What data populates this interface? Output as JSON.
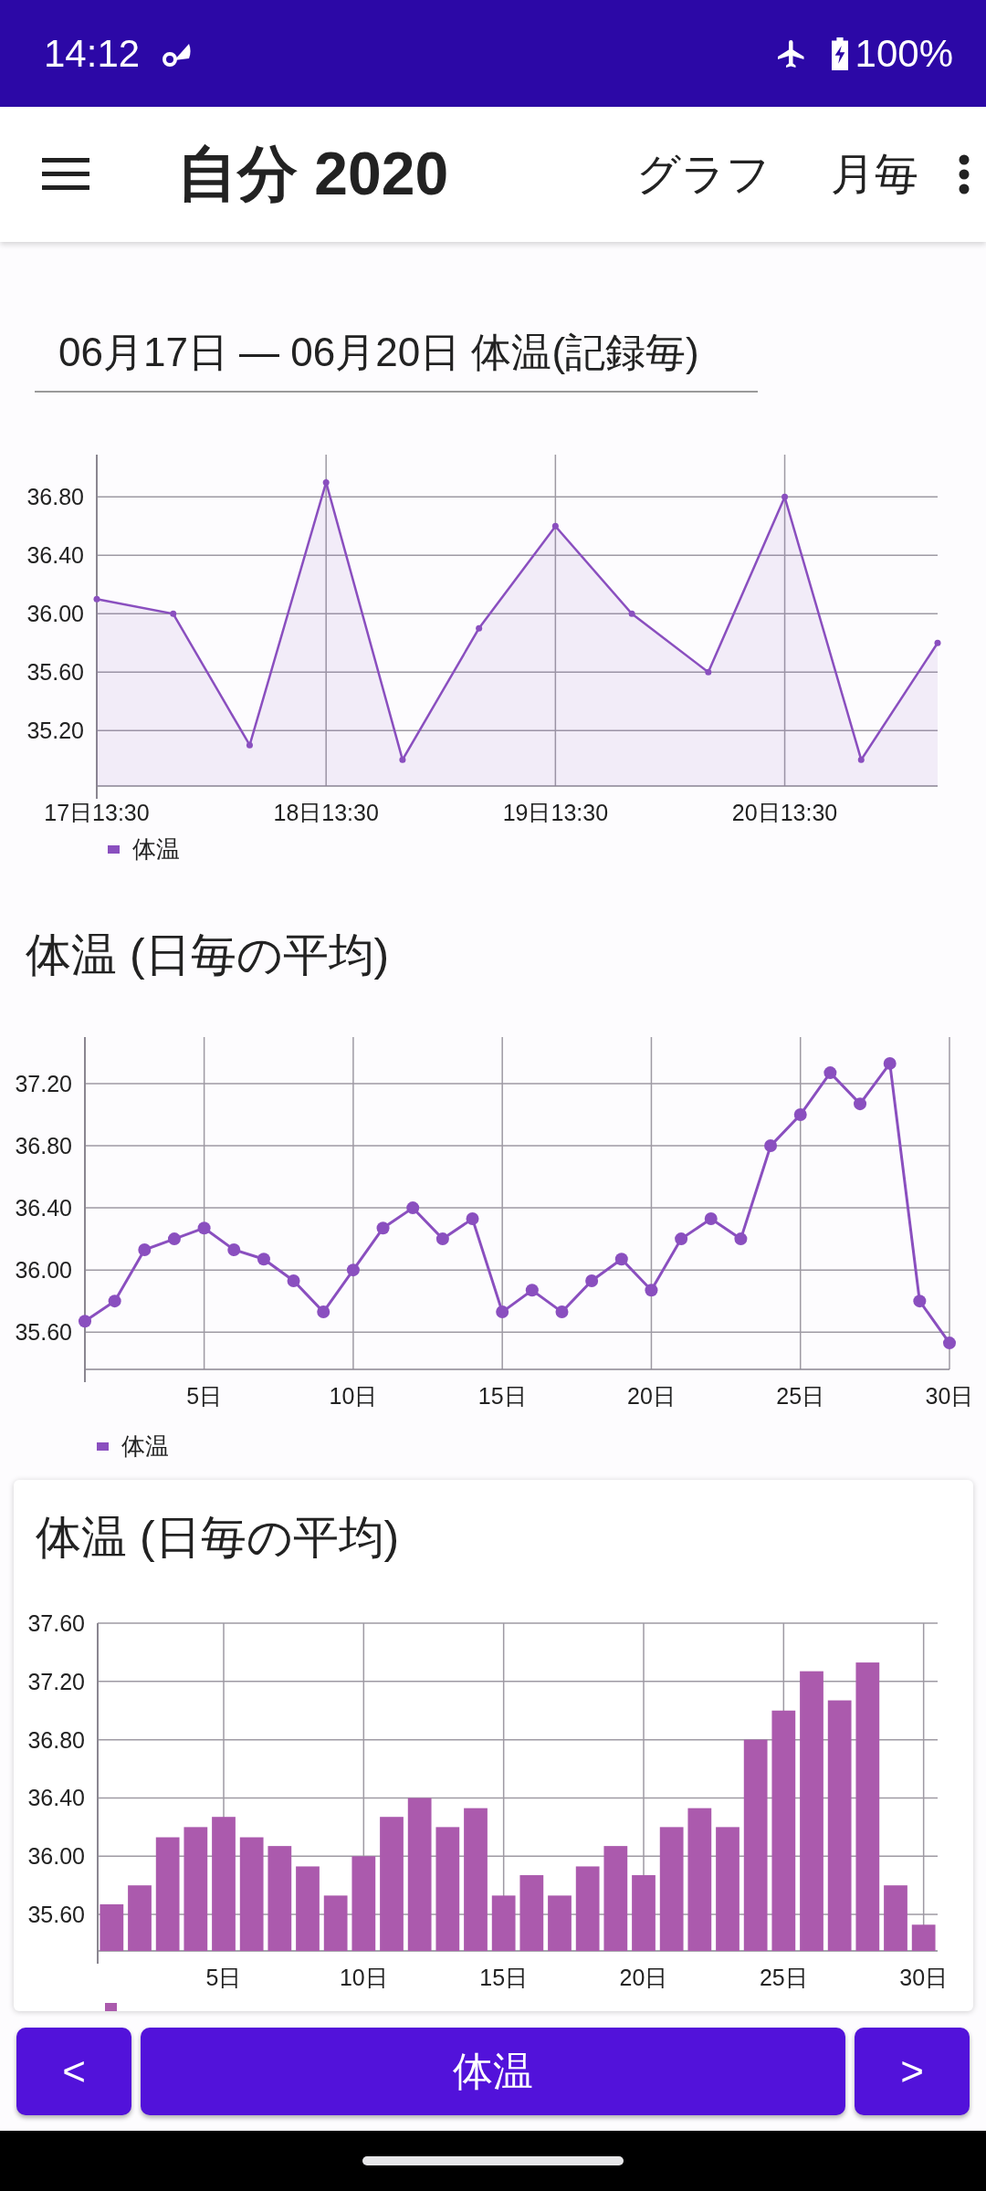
{
  "status_bar": {
    "time": "14:12",
    "battery": "100%"
  },
  "app_bar": {
    "title": "自分 2020",
    "actions": [
      "グラフ",
      "月毎"
    ]
  },
  "period_field": {
    "value": "06月17日 — 06月20日 体温(記録毎)"
  },
  "charts": [
    {
      "kind": "plain",
      "chart_data": {
        "type": "area",
        "grid": true,
        "categories": [
          "17日13:30",
          null,
          null,
          "18日13:30",
          null,
          null,
          "19日13:30",
          null,
          null,
          "20日13:30",
          null,
          null
        ],
        "series": [
          {
            "name": "体温",
            "color": "#8a4fbf",
            "marker": true,
            "values": [
              36.1,
              36.0,
              35.1,
              36.9,
              35.0,
              35.9,
              36.6,
              36.0,
              35.6,
              36.8,
              35.0,
              35.8
            ]
          }
        ],
        "ylim": [
          34.82,
          37.09
        ],
        "yticks": [
          {
            "value": 35.2,
            "label": "35.20"
          },
          {
            "value": 35.6,
            "label": "35.60"
          },
          {
            "value": 36.0,
            "label": "36.00"
          },
          {
            "value": 36.4,
            "label": "36.40"
          },
          {
            "value": 36.8,
            "label": "36.80"
          }
        ]
      }
    },
    {
      "kind": "plain",
      "chart_data": {
        "type": "line",
        "grid": true,
        "title": "体温 (日毎の平均)",
        "x": [
          1,
          2,
          3,
          4,
          5,
          6,
          7,
          8,
          9,
          10,
          11,
          12,
          13,
          14,
          15,
          16,
          17,
          18,
          19,
          20,
          21,
          22,
          23,
          24,
          25,
          26,
          27,
          28,
          29,
          30
        ],
        "series": [
          {
            "name": "体温",
            "color": "#8a4fbf",
            "marker": true,
            "values": [
              35.67,
              35.8,
              36.13,
              36.2,
              36.27,
              36.13,
              36.07,
              35.93,
              35.73,
              36.0,
              36.27,
              36.4,
              36.2,
              36.33,
              35.73,
              35.87,
              35.73,
              35.93,
              36.07,
              35.87,
              36.2,
              36.33,
              36.2,
              36.8,
              37.0,
              37.27,
              37.07,
              37.33,
              35.8,
              35.53
            ]
          }
        ],
        "xlim": [
          1,
          30
        ],
        "ylim": [
          35.36,
          37.5
        ],
        "xticks": [
          {
            "value": 5,
            "label": "5日"
          },
          {
            "value": 10,
            "label": "10日"
          },
          {
            "value": 15,
            "label": "15日"
          },
          {
            "value": 20,
            "label": "20日"
          },
          {
            "value": 25,
            "label": "25日"
          },
          {
            "value": 30,
            "label": "30日"
          }
        ],
        "yticks": [
          {
            "value": 35.6,
            "label": "35.60"
          },
          {
            "value": 36.0,
            "label": "36.00"
          },
          {
            "value": 36.4,
            "label": "36.40"
          },
          {
            "value": 36.8,
            "label": "36.80"
          },
          {
            "value": 37.2,
            "label": "37.20"
          }
        ]
      }
    },
    {
      "kind": "card",
      "chart_data": {
        "type": "bar",
        "grid": true,
        "title": "体温 (日毎の平均)",
        "x": [
          1,
          2,
          3,
          4,
          5,
          6,
          7,
          8,
          9,
          10,
          11,
          12,
          13,
          14,
          15,
          16,
          17,
          18,
          19,
          20,
          21,
          22,
          23,
          24,
          25,
          26,
          27,
          28,
          29,
          30
        ],
        "series": [
          {
            "color": "#ab5aad",
            "values": [
              35.67,
              35.8,
              36.13,
              36.2,
              36.27,
              36.13,
              36.07,
              35.93,
              35.73,
              36.0,
              36.27,
              36.4,
              36.2,
              36.33,
              35.73,
              35.87,
              35.73,
              35.93,
              36.07,
              35.87,
              36.2,
              36.33,
              36.2,
              36.8,
              37.0,
              37.27,
              37.07,
              37.33,
              35.8,
              35.53
            ]
          }
        ],
        "xlim": [
          0.5,
          30.5
        ],
        "ylim": [
          35.35,
          37.6
        ],
        "xticks": [
          {
            "value": 5,
            "label": "5日"
          },
          {
            "value": 10,
            "label": "10日"
          },
          {
            "value": 15,
            "label": "15日"
          },
          {
            "value": 20,
            "label": "20日"
          },
          {
            "value": 25,
            "label": "25日"
          },
          {
            "value": 30,
            "label": "30日"
          }
        ],
        "yticks": [
          {
            "value": 35.6,
            "label": "35.60"
          },
          {
            "value": 36.0,
            "label": "36.00"
          },
          {
            "value": 36.4,
            "label": "36.40"
          },
          {
            "value": 36.8,
            "label": "36.80"
          },
          {
            "value": 37.2,
            "label": "37.20"
          },
          {
            "value": 37.6,
            "label": "37.60"
          }
        ]
      }
    }
  ],
  "bottom_bar": {
    "prev": "<",
    "label": "体温",
    "next": ">"
  }
}
